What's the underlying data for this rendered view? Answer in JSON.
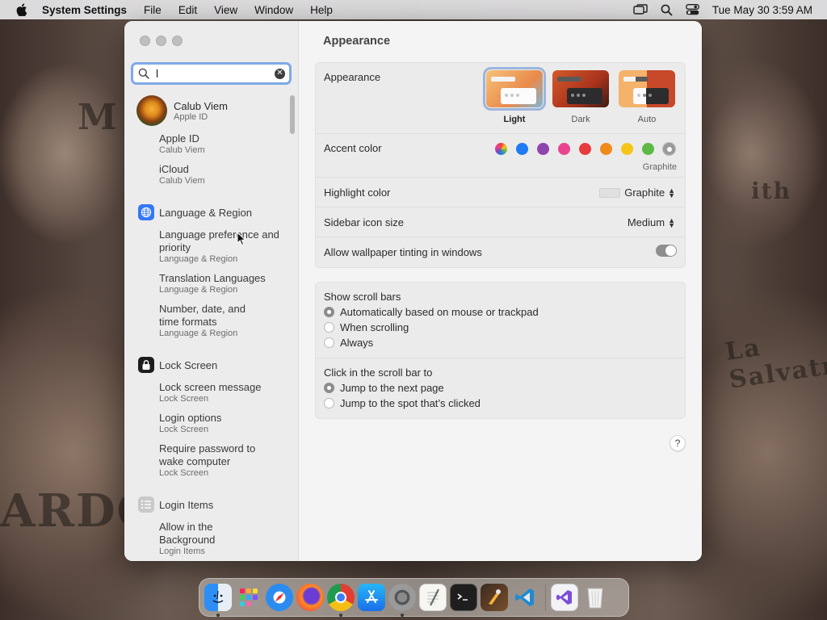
{
  "menubar": {
    "app_name": "System Settings",
    "items": [
      "File",
      "Edit",
      "View",
      "Window",
      "Help"
    ],
    "clock": "Tue May 30  3:59 AM"
  },
  "wallpaper": {
    "marks": [
      "M",
      "La Salvatru",
      "ARDO",
      "ith"
    ]
  },
  "search": {
    "value": "l"
  },
  "sidebar": {
    "profile": {
      "name": "Calub Viem",
      "sub": "Apple ID"
    },
    "results": [
      {
        "title": "Apple ID",
        "sub": "Calub Viem"
      },
      {
        "title": "iCloud",
        "sub": "Calub Viem"
      },
      {
        "category": "Language & Region",
        "icon": "globe-icon",
        "color": "#3478f6"
      },
      {
        "title": "Language preference and priority",
        "sub": "Language & Region"
      },
      {
        "title": "Translation Languages",
        "sub": "Language & Region"
      },
      {
        "title": "Number, date, and time formats",
        "sub": "Language & Region"
      },
      {
        "category": "Lock Screen",
        "icon": "lock-icon",
        "color": "#1d1d1f"
      },
      {
        "title": "Lock screen message",
        "sub": "Lock Screen"
      },
      {
        "title": "Login options",
        "sub": "Lock Screen"
      },
      {
        "title": "Require password to wake computer",
        "sub": "Lock Screen"
      },
      {
        "category": "Login Items",
        "icon": "list-icon",
        "color": "#8e8e93"
      },
      {
        "title": "Allow in the Background",
        "sub": "Login Items"
      }
    ]
  },
  "main": {
    "title": "Appearance",
    "appearance": {
      "label": "Appearance",
      "options": [
        {
          "label": "Light",
          "selected": true
        },
        {
          "label": "Dark",
          "selected": false
        },
        {
          "label": "Auto",
          "selected": false
        }
      ]
    },
    "accent": {
      "label": "Accent color",
      "colors": [
        "multicolor",
        "#1e7bf3",
        "#8f44ad",
        "#e9448f",
        "#e73c3c",
        "#f08a1c",
        "#f5c518",
        "#5cb943",
        "#8e8e8e"
      ],
      "selected_name": "Graphite"
    },
    "highlight": {
      "label": "Highlight color",
      "value": "Graphite"
    },
    "sidebar_icon": {
      "label": "Sidebar icon size",
      "value": "Medium"
    },
    "tinting": {
      "label": "Allow wallpaper tinting in windows",
      "on": true
    },
    "scroll_bars": {
      "label": "Show scroll bars",
      "options": [
        {
          "label": "Automatically based on mouse or trackpad",
          "selected": true
        },
        {
          "label": "When scrolling",
          "selected": false
        },
        {
          "label": "Always",
          "selected": false
        }
      ]
    },
    "click_scroll": {
      "label": "Click in the scroll bar to",
      "options": [
        {
          "label": "Jump to the next page",
          "selected": true
        },
        {
          "label": "Jump to the spot that’s clicked",
          "selected": false
        }
      ]
    },
    "help": "?"
  },
  "dock": {
    "apps": [
      "finder-icon",
      "launchpad-icon",
      "safari-icon",
      "firefox-icon",
      "chrome-icon",
      "app-store-icon",
      "system-settings-icon",
      "textedit-icon",
      "terminal-icon",
      "instruments-icon",
      "vscode-icon",
      "visual-studio-icon",
      "trash-icon"
    ]
  }
}
